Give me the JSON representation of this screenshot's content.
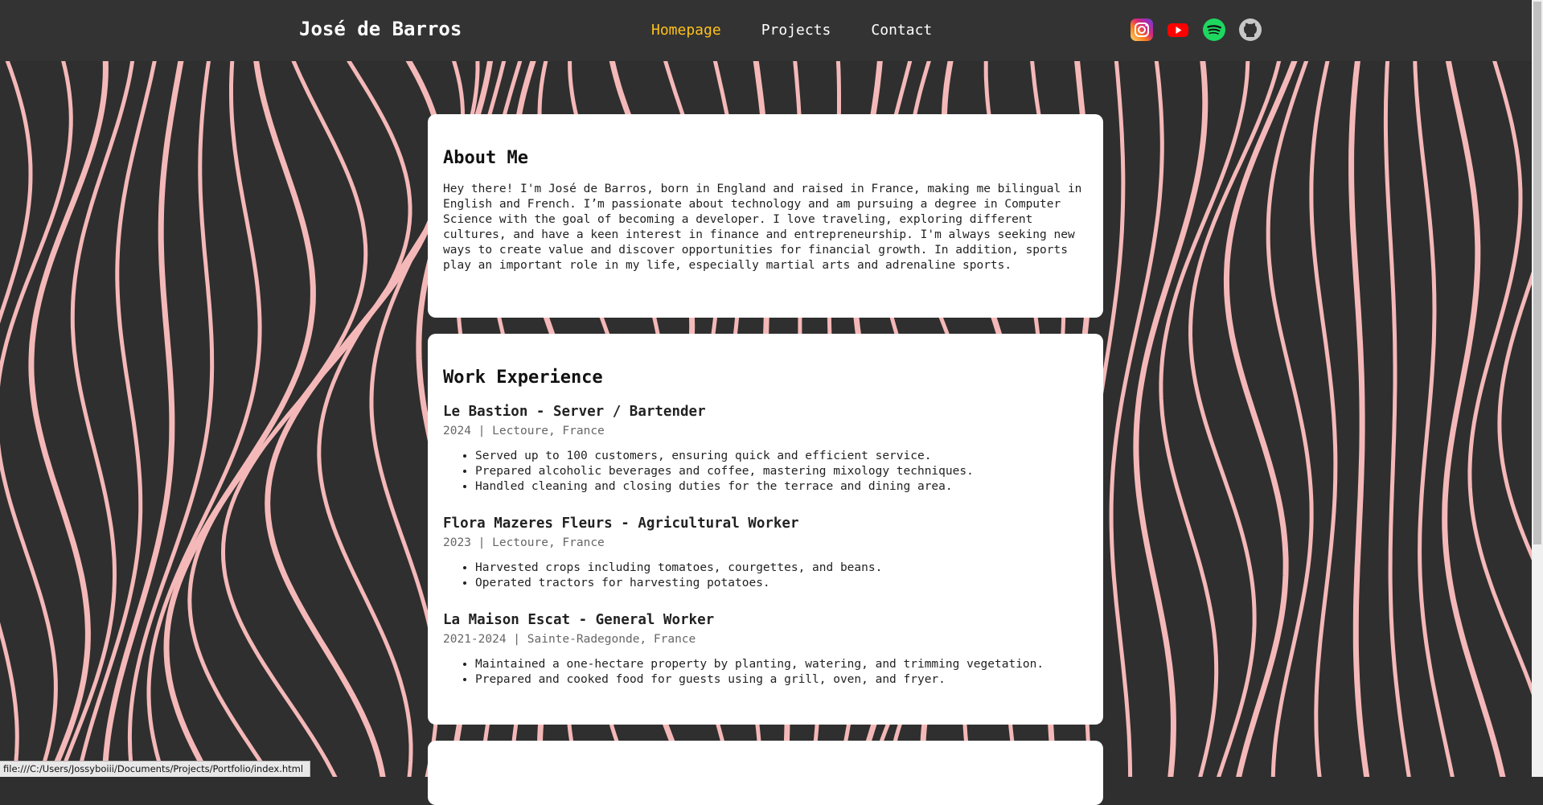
{
  "header": {
    "brand": "José de Barros",
    "nav": [
      {
        "label": "Homepage",
        "active": true
      },
      {
        "label": "Projects",
        "active": false
      },
      {
        "label": "Contact",
        "active": false
      }
    ],
    "socials": [
      "instagram-icon",
      "youtube-icon",
      "spotify-icon",
      "github-icon"
    ]
  },
  "about": {
    "title": "About Me",
    "text": "Hey there! I'm José de Barros, born in England and raised in France, making me bilingual in English and French. I’m passionate about technology and am pursuing a degree in Computer Science with the goal of becoming a developer. I love traveling, exploring different cultures, and have a keen interest in finance and entrepreneurship. I'm always seeking new ways to create value and discover opportunities for financial growth. In addition, sports play an important role in my life, especially martial arts and adrenaline sports."
  },
  "work": {
    "title": "Work Experience",
    "jobs": [
      {
        "title": "Le Bastion - Server / Bartender",
        "meta": "2024 | Lectoure, France",
        "bullets": [
          "Served up to 100 customers, ensuring quick and efficient service.",
          "Prepared alcoholic beverages and coffee, mastering mixology techniques.",
          "Handled cleaning and closing duties for the terrace and dining area."
        ]
      },
      {
        "title": "Flora Mazeres Fleurs - Agricultural Worker",
        "meta": "2023 | Lectoure, France",
        "bullets": [
          "Harvested crops including tomatoes, courgettes, and beans.",
          "Operated tractors for harvesting potatoes."
        ]
      },
      {
        "title": "La Maison Escat - General Worker",
        "meta": "2021-2024 | Sainte-Radegonde, France",
        "bullets": [
          "Maintained a one-hectare property by planting, watering, and trimming vegetation.",
          "Prepared and cooked food for guests using a grill, oven, and fryer."
        ]
      }
    ]
  },
  "status_url": "file:///C:/Users/Jossyboiii/Documents/Projects/Portfolio/index.html",
  "colors": {
    "header_bg": "#333333",
    "nav_active": "#ffc21a",
    "wave_line": "#f5b8b8",
    "wave_bg": "#2f2f2f"
  }
}
